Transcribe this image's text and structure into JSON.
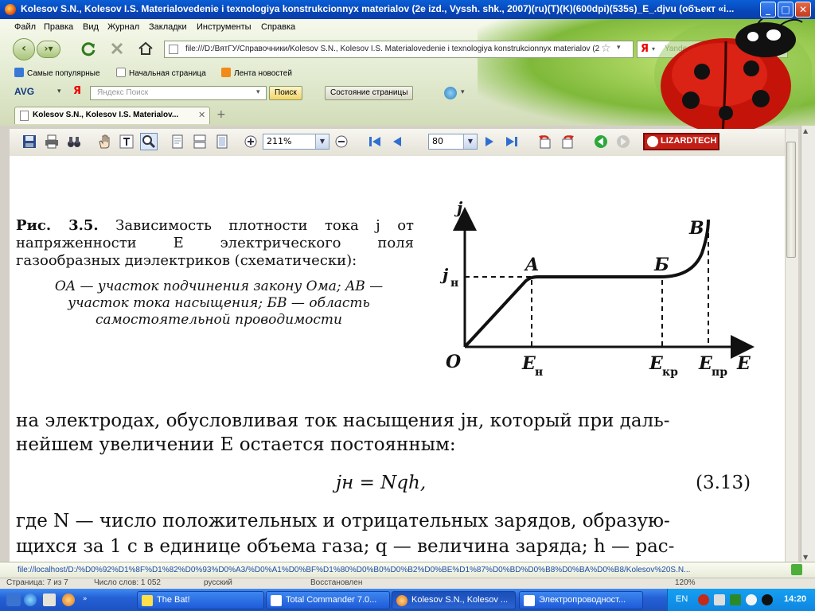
{
  "window": {
    "title": "Kolesov S.N., Kolesov I.S. Materialovedenie i texnologiya konstrukcionnyx materialov (2e izd., Vyssh. shk., 2007)(ru)(T)(K)(600dpi)(535s)_E_.djvu (объект «i..."
  },
  "menu": [
    "Файл",
    "Правка",
    "Вид",
    "Журнал",
    "Закладки",
    "Инструменты",
    "Справка"
  ],
  "nav": {
    "url": "file:///D:/ВятГУ/Справочники/Kolesov S.N., Kolesov I.S. Materialovedenie i texnologiya konstrukcionnyx materialov (2e izd.",
    "search_engine": "Я",
    "search_placeholder": "Yandex Search"
  },
  "bookmarks": [
    "Самые популярные",
    "Начальная страница",
    "Лента новостей"
  ],
  "avg_toolbar": {
    "brand": "AVG",
    "search_engine": "Я",
    "search_placeholder": "Яндекс Поиск",
    "search_button": "Поиск",
    "page_status_button": "Состояние страницы"
  },
  "tab": {
    "label": "Kolesov S.N., Kolesov I.S. Materialov..."
  },
  "viewer": {
    "zoom": "211%",
    "page": "80",
    "brand": "LIZARDTECH"
  },
  "document": {
    "caption_bold": "Рис. 3.5.",
    "caption_text": "Зависимость плотности тока j от напряженности E электрического поля газообразных диэлектриков (схематически):",
    "caption_desc": "OA — участок подчинения закону Ома; AB — участок тока насыщения; БВ — область самостоятельной проводимости",
    "graph": {
      "y_axis": "j",
      "x_axis": "E",
      "origin": "O",
      "jn": "j",
      "jn_sub": "н",
      "point_a": "A",
      "point_b": "Б",
      "point_v": "B",
      "e_n": "E",
      "e_n_sub": "н",
      "e_kr": "E",
      "e_kr_sub": "кр",
      "e_pr": "E",
      "e_pr_sub": "пр"
    },
    "line1": "на электродах, обусловливая ток насыщения jн, который при даль-",
    "line2": "нейшем увеличении E остается постоянным:",
    "equation": "jн = Nqh,",
    "equation_number": "(3.13)",
    "line3": "где N — число положительных и отрицательных зарядов, образую-",
    "line4": "щихся за 1 с в единице объема газа; q — величина заряда; h — рас-"
  },
  "status": {
    "url": "file://localhost/D:/%D0%92%D1%8F%D1%82%D0%93%D0%A3/%D0%A1%D0%BF%D1%80%D0%B0%D0%B2%D0%BE%D1%87%D0%BD%D0%B8%D0%BA%D0%B8/Kolesov%20S.N..."
  },
  "app_status": {
    "left": "Страница: 7 из 7",
    "words": "Число слов: 1 052",
    "lang": "русский",
    "mode": "Восстановлен",
    "zoom": "120%"
  },
  "taskbar": {
    "tasks": [
      "The Bat!",
      "Total Commander 7.0...",
      "Kolesov S.N., Kolesov ...",
      "Электропроводност..."
    ],
    "lang": "EN",
    "clock": "14:20"
  }
}
